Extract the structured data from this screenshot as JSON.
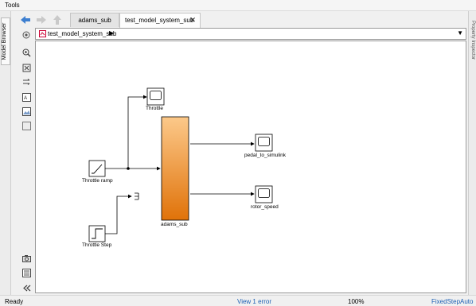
{
  "menu": {
    "tools": "Tools"
  },
  "sidebar": {
    "model_browser": "Model Browser",
    "property_inspector": "Property Inspector"
  },
  "tabs": [
    {
      "label": "adams_sub"
    },
    {
      "label": "test_model_system_sub",
      "close": "✕"
    }
  ],
  "address": {
    "path": "test_model_system_sub",
    "arrow": "▶",
    "dropdown": "▼"
  },
  "blocks": {
    "throttle_scope": "Throttle",
    "throttle_ramp": "Throttle ramp",
    "throttle_step": "Throttle Step",
    "subsystem": "adams_sub",
    "pedal_scope": "pedal_to_simulink",
    "rotor_scope": "rotor_speed"
  },
  "toolbar_icons": [
    "zoom-in-icon",
    "fit-view-icon",
    "signal-arrow-icon",
    "annotation-icon",
    "image-icon",
    "area-icon",
    "camera-icon",
    "list-icon",
    "collapse-icon"
  ],
  "status": {
    "ready": "Ready",
    "errors": "View 1 error",
    "zoom": "100%",
    "solver": "FixedStepAuto"
  },
  "colors": {
    "subsystem_top": "#fcc98a",
    "subsystem_bottom": "#e07209",
    "link": "#1a5fb4"
  }
}
